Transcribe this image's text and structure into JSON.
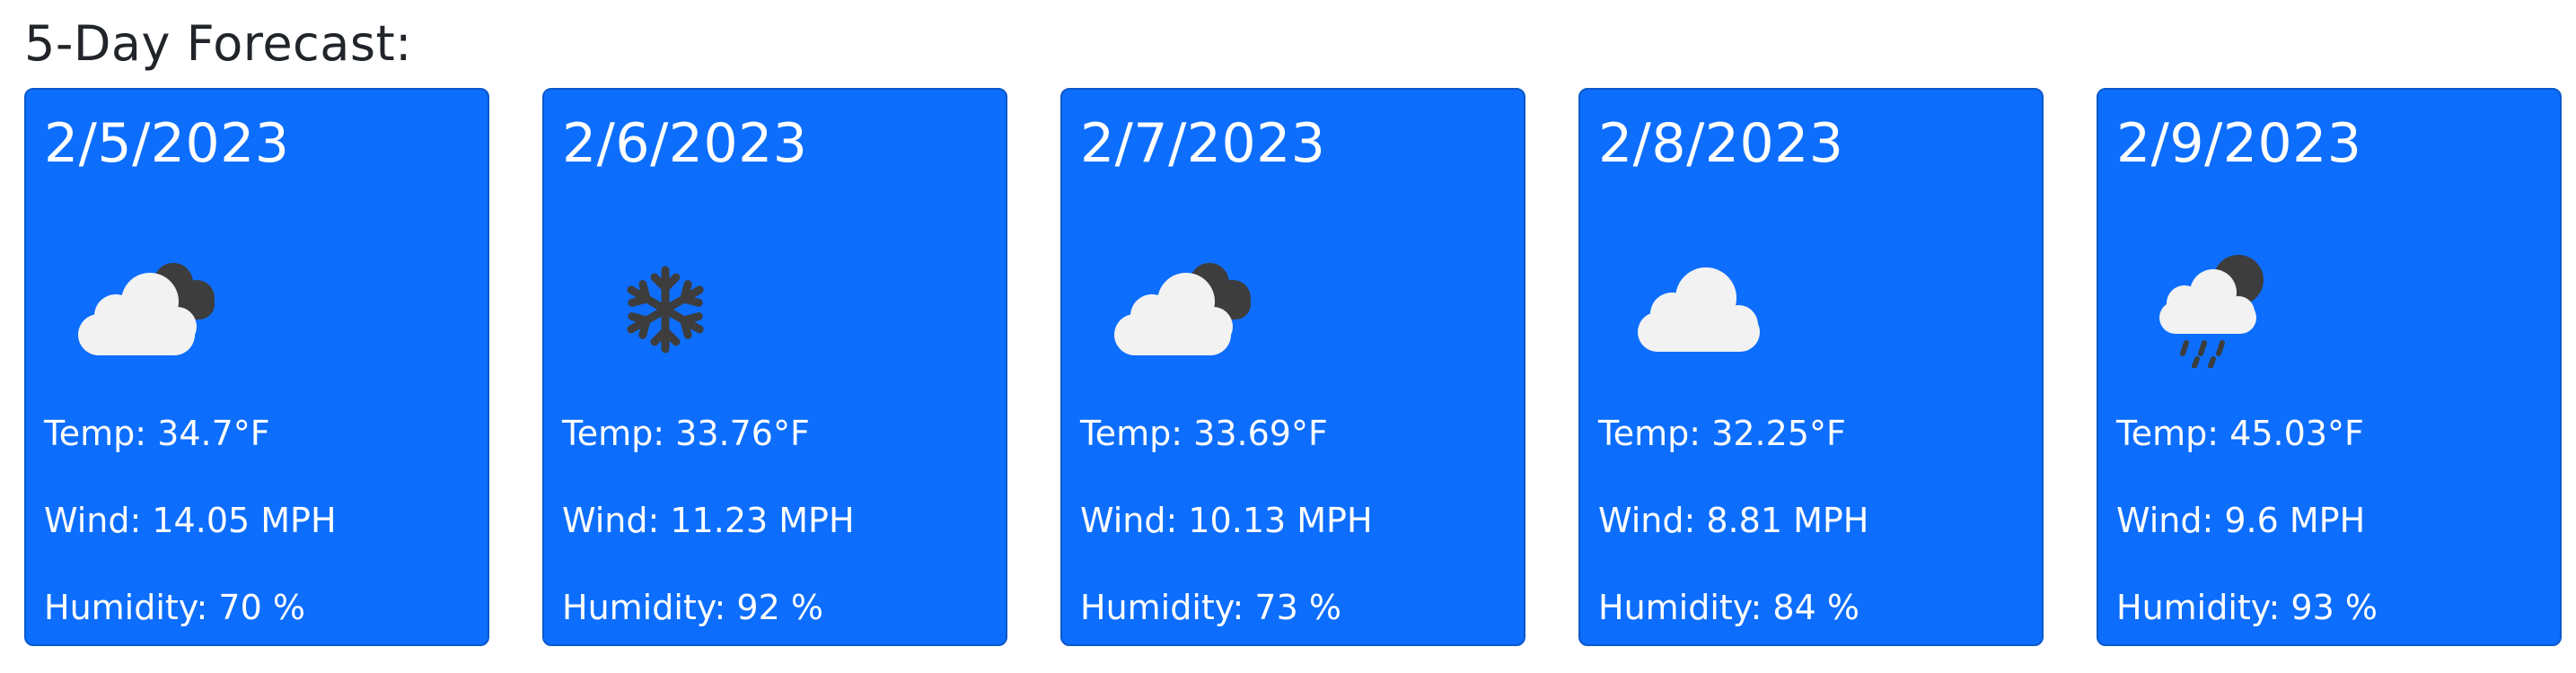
{
  "forecast": {
    "title": "5-Day Forecast:",
    "days": [
      {
        "date": "2/5/2023",
        "icon": "broken-clouds-icon",
        "temp": "Temp: 34.7°F",
        "wind": "Wind: 14.05 MPH",
        "humidity": "Humidity: 70 %"
      },
      {
        "date": "2/6/2023",
        "icon": "snow-icon",
        "temp": "Temp: 33.76°F",
        "wind": "Wind: 11.23 MPH",
        "humidity": "Humidity: 92 %"
      },
      {
        "date": "2/7/2023",
        "icon": "broken-clouds-icon",
        "temp": "Temp: 33.69°F",
        "wind": "Wind: 10.13 MPH",
        "humidity": "Humidity: 73 %"
      },
      {
        "date": "2/8/2023",
        "icon": "cloud-icon",
        "temp": "Temp: 32.25°F",
        "wind": "Wind: 8.81 MPH",
        "humidity": "Humidity: 84 %"
      },
      {
        "date": "2/9/2023",
        "icon": "rain-night-icon",
        "temp": "Temp: 45.03°F",
        "wind": "Wind: 9.6 MPH",
        "humidity": "Humidity: 93 %"
      }
    ]
  },
  "colors": {
    "card_bg": "#0d6efd",
    "card_border": "#0a58ca",
    "title_text": "#212529",
    "icon_dark": "#3d3d3d",
    "icon_light": "#f2f2f2"
  }
}
